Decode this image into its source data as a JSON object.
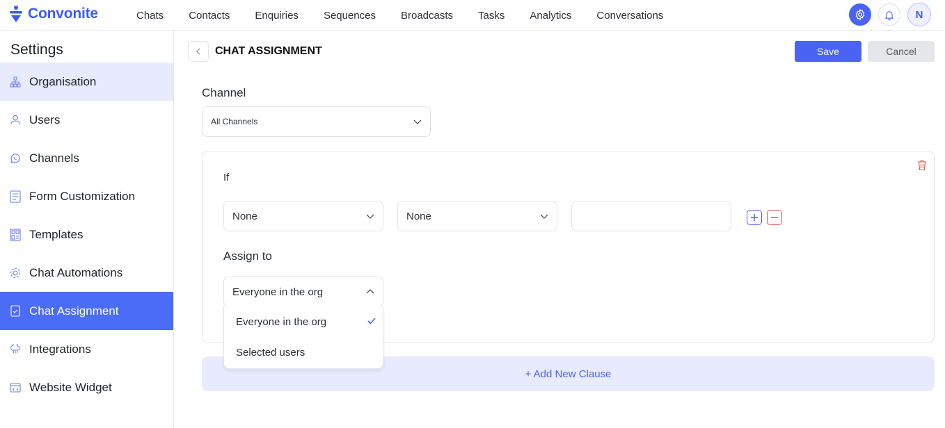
{
  "brand": {
    "name": "Convonite",
    "color": "#3d5cf5"
  },
  "nav": {
    "items": [
      "Chats",
      "Contacts",
      "Enquiries",
      "Sequences",
      "Broadcasts",
      "Tasks",
      "Analytics",
      "Conversations"
    ]
  },
  "header_right": {
    "settings_icon": "gear-icon",
    "notifications_icon": "bell-icon",
    "avatar_initial": "N"
  },
  "sidebar": {
    "title": "Settings",
    "items": [
      {
        "label": "Organisation",
        "icon": "org-chart-icon",
        "state": "hover"
      },
      {
        "label": "Users",
        "icon": "user-icon",
        "state": ""
      },
      {
        "label": "Channels",
        "icon": "whatsapp-icon",
        "state": ""
      },
      {
        "label": "Form Customization",
        "icon": "form-icon",
        "state": ""
      },
      {
        "label": "Templates",
        "icon": "template-icon",
        "state": ""
      },
      {
        "label": "Chat Automations",
        "icon": "automation-icon",
        "state": ""
      },
      {
        "label": "Chat Assignment",
        "icon": "assignment-icon",
        "state": "active"
      },
      {
        "label": "Integrations",
        "icon": "integrations-icon",
        "state": ""
      },
      {
        "label": "Website Widget",
        "icon": "widget-icon",
        "state": ""
      }
    ]
  },
  "page": {
    "title": "CHAT ASSIGNMENT",
    "save_label": "Save",
    "cancel_label": "Cancel",
    "channel_label": "Channel",
    "channel_value": "All Channels",
    "clause": {
      "if_label": "If",
      "condition_field": "None",
      "condition_operator": "None",
      "condition_value": "",
      "assign_label": "Assign to",
      "assign_value": "Everyone in the org",
      "assign_options": [
        "Everyone in the org",
        "Selected users"
      ],
      "assign_selected_index": 0
    },
    "add_clause_label": "+ Add New Clause"
  },
  "colors": {
    "accent": "#4a63f5",
    "active_sidebar": "#4a6cf7",
    "hover_sidebar": "#e8ebfd",
    "danger": "#e0524c"
  }
}
